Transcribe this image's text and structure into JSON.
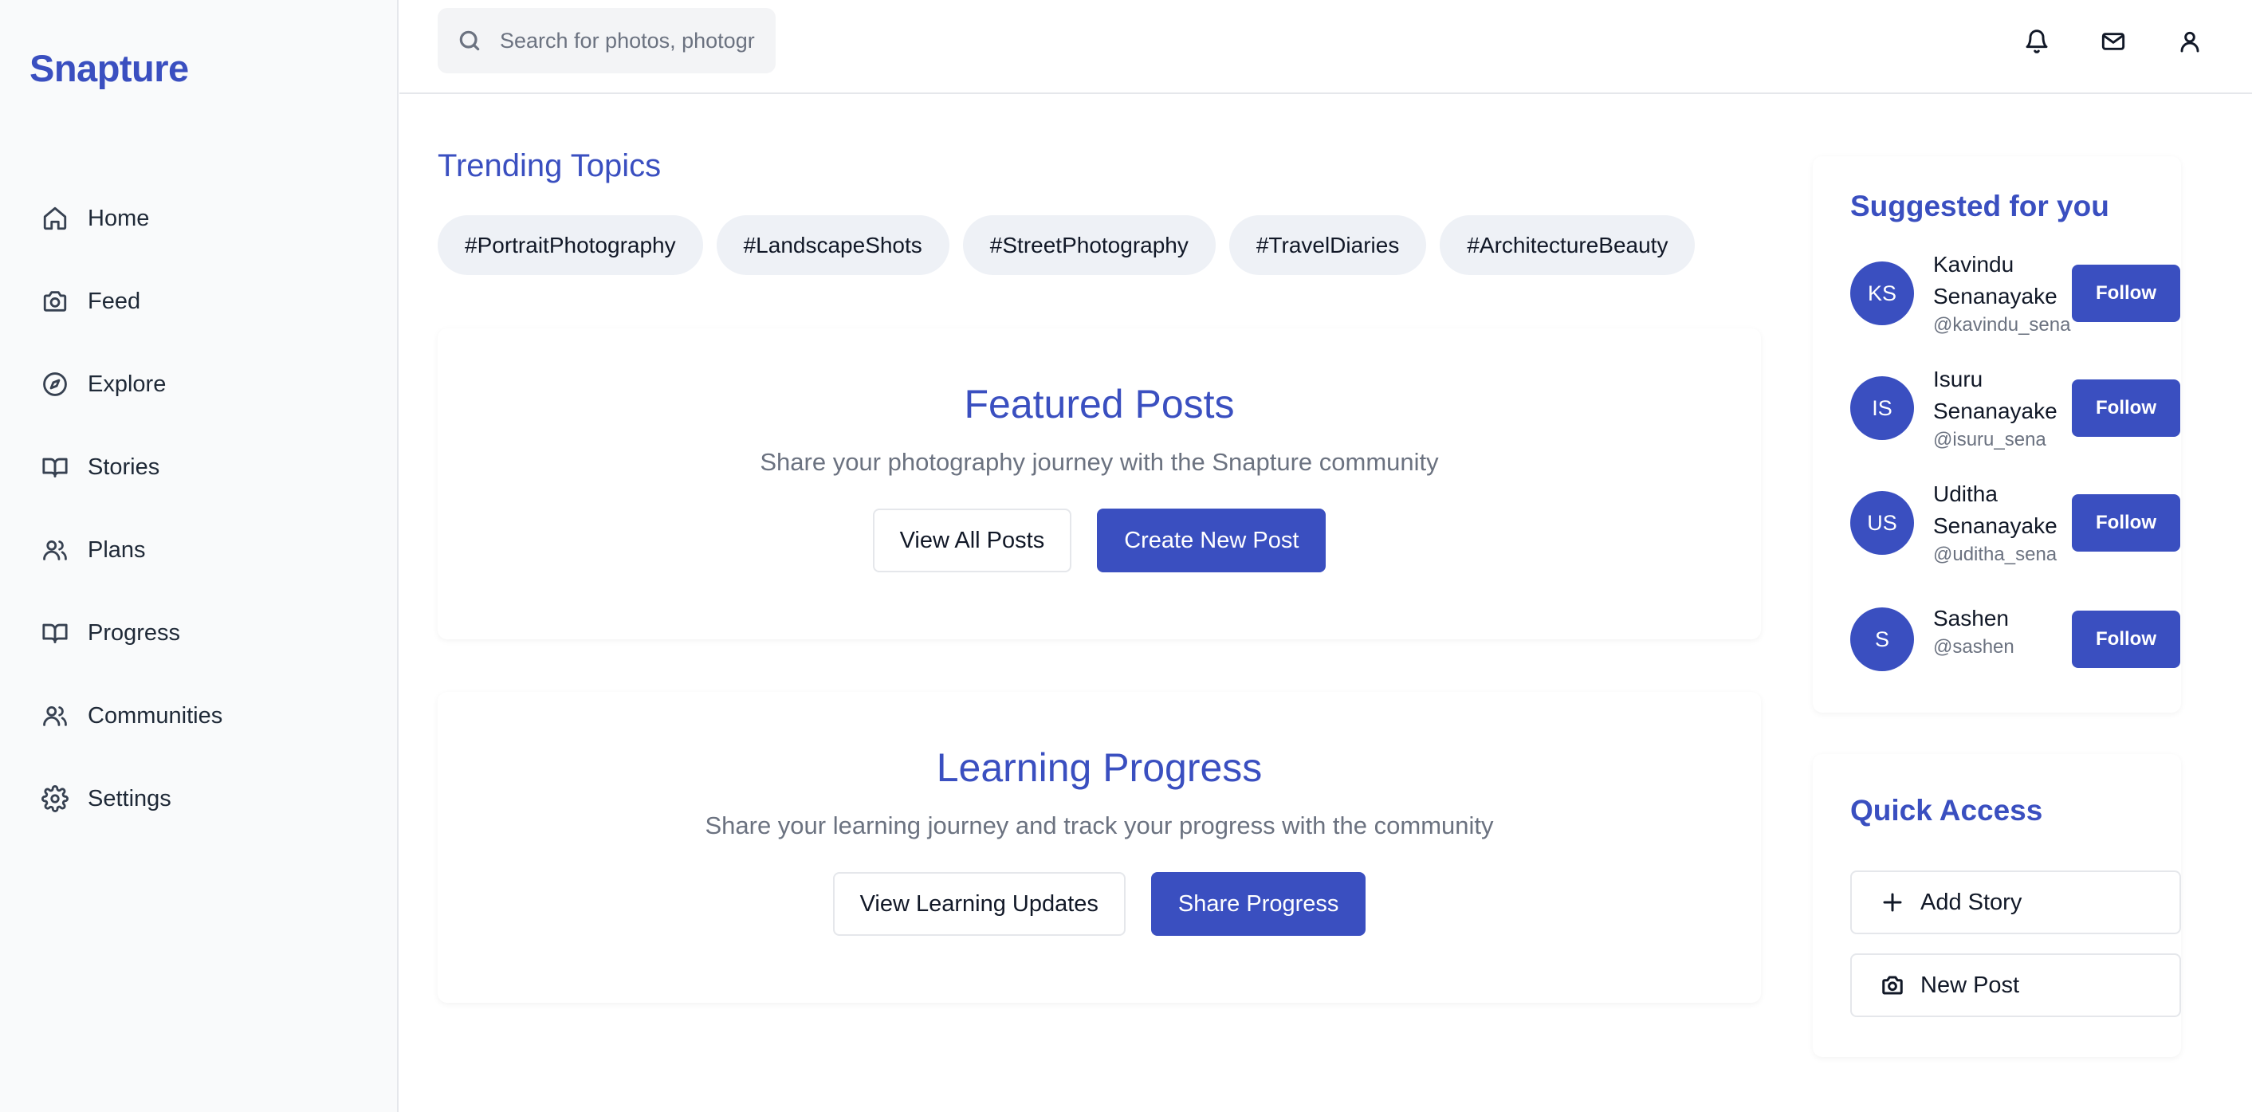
{
  "app": {
    "name": "Snapture",
    "accent_color": "#3a4fc0"
  },
  "sidebar": {
    "items": [
      {
        "label": "Home",
        "icon": "home-icon"
      },
      {
        "label": "Feed",
        "icon": "camera-icon"
      },
      {
        "label": "Explore",
        "icon": "compass-icon"
      },
      {
        "label": "Stories",
        "icon": "book-open-icon"
      },
      {
        "label": "Plans",
        "icon": "users-icon"
      },
      {
        "label": "Progress",
        "icon": "book-open-icon"
      },
      {
        "label": "Communities",
        "icon": "users-icon"
      },
      {
        "label": "Settings",
        "icon": "gear-icon"
      }
    ]
  },
  "header": {
    "search_placeholder": "Search for photos, photographers...",
    "icons": [
      "bell-icon",
      "mail-icon",
      "user-icon"
    ]
  },
  "trending": {
    "title": "Trending Topics",
    "tags": [
      "#PortraitPhotography",
      "#LandscapeShots",
      "#StreetPhotography",
      "#TravelDiaries",
      "#ArchitectureBeauty"
    ]
  },
  "featured": {
    "title": "Featured Posts",
    "subtitle": "Share your photography journey with the Snapture community",
    "secondary_label": "View All Posts",
    "primary_label": "Create New Post"
  },
  "learning": {
    "title": "Learning Progress",
    "subtitle": "Share your learning journey and track your progress with the community",
    "secondary_label": "View Learning Updates",
    "primary_label": "Share Progress"
  },
  "suggested": {
    "title": "Suggested for you",
    "follow_label": "Follow",
    "users": [
      {
        "initials": "KS",
        "name": "Kavindu Senanayake",
        "handle": "@kavindu_sena"
      },
      {
        "initials": "IS",
        "name": "Isuru Senanayake",
        "handle": "@isuru_sena"
      },
      {
        "initials": "US",
        "name": "Uditha Senanayake",
        "handle": "@uditha_sena"
      },
      {
        "initials": "S",
        "name": "Sashen",
        "handle": "@sashen"
      }
    ]
  },
  "quick_access": {
    "title": "Quick Access",
    "items": [
      {
        "label": "Add Story",
        "icon": "plus-icon"
      },
      {
        "label": "New Post",
        "icon": "camera-icon"
      }
    ]
  }
}
